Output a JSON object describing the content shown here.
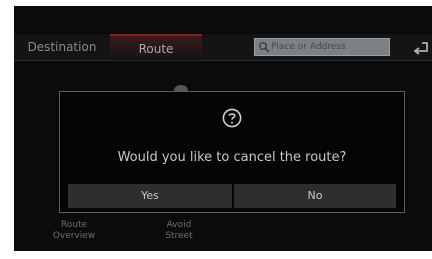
{
  "tabs": [
    {
      "label": "Destination"
    },
    {
      "label": "Route"
    }
  ],
  "search": {
    "placeholder": "Place or Address"
  },
  "background": {
    "route_overview": "Route\nOverview",
    "avoid_street": "Avoid\nStreet"
  },
  "dialog": {
    "message": "Would you like to cancel the route?",
    "yes_label": "Yes",
    "no_label": "No"
  },
  "colors": {
    "accent": "#8a2020",
    "background": "#0b0b0b",
    "button": "#2e2e2e"
  }
}
